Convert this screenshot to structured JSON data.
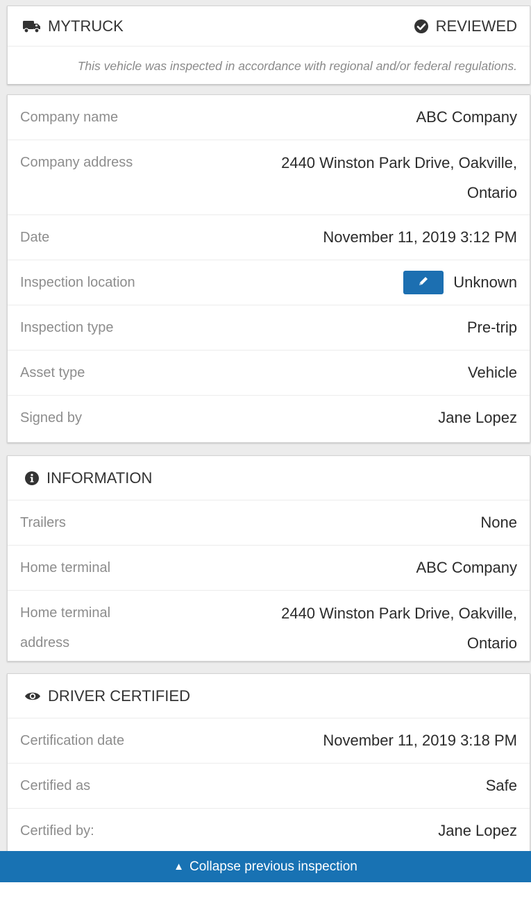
{
  "header": {
    "vehicle_name": "MYTRUCK",
    "status": "REVIEWED",
    "note": "This vehicle was inspected in accordance with regional and/or federal regulations."
  },
  "details": {
    "rows": [
      {
        "label": "Company name",
        "value": "ABC Company"
      },
      {
        "label": "Company address",
        "value_line1": "2440 Winston Park Drive, Oakville,",
        "value_line2": "Ontario"
      },
      {
        "label": "Date",
        "value": "November 11, 2019 3:12 PM"
      },
      {
        "label": "Inspection location",
        "value": "Unknown"
      },
      {
        "label": "Inspection type",
        "value": "Pre-trip"
      },
      {
        "label": "Asset type",
        "value": "Vehicle"
      },
      {
        "label": "Signed by",
        "value": "Jane Lopez"
      }
    ]
  },
  "information": {
    "title": "INFORMATION",
    "rows": [
      {
        "label": "Trailers",
        "value": "None"
      },
      {
        "label": "Home terminal",
        "value": "ABC Company"
      },
      {
        "label_line1": "Home terminal",
        "label_line2": "address",
        "value_line1": "2440 Winston Park Drive, Oakville,",
        "value_line2": "Ontario"
      }
    ]
  },
  "driver": {
    "title": "DRIVER CERTIFIED",
    "rows": [
      {
        "label": "Certification date",
        "value": "November 11, 2019 3:18 PM"
      },
      {
        "label": "Certified as",
        "value": "Safe"
      },
      {
        "label": "Certified by:",
        "value": "Jane Lopez"
      }
    ]
  },
  "footer": {
    "collapse_label": "Collapse previous inspection"
  },
  "icons": {
    "vehicle": "truck-icon",
    "reviewed": "check-circle-icon",
    "edit": "pencil-icon",
    "information": "info-circle-icon",
    "driver": "eye-icon",
    "collapse": "triangle-up-icon"
  },
  "colors": {
    "accent": "#1872b3",
    "edit_button": "#1c6fb1",
    "label_text": "#8d8d8d",
    "value_text": "#2b2b2b",
    "background": "#ececec"
  }
}
